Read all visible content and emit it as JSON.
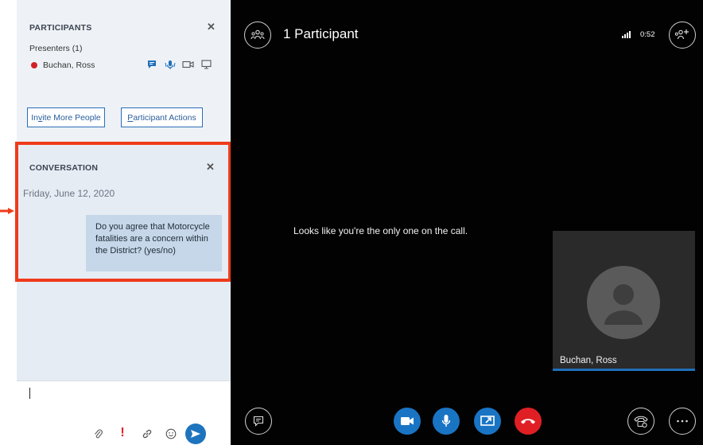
{
  "participants": {
    "title": "PARTICIPANTS",
    "presenters_label": "Presenters (1)",
    "presenter_name": "Buchan, Ross",
    "invite_button": {
      "prefix": "In",
      "underlined": "v",
      "suffix": "ite More People"
    },
    "actions_button": {
      "underlined": "P",
      "suffix": "articipant Actions"
    }
  },
  "conversation": {
    "title": "CONVERSATION",
    "date": "Friday, June 12, 2020",
    "message": "Do you agree that Motorcycle fatalities are a concern within the District? (yes/no)"
  },
  "call": {
    "title": "1 Participant",
    "timer": "0:52",
    "empty_message": "Looks like you're the only one on the call.",
    "self_name": "Buchan, Ross"
  },
  "colors": {
    "highlight": "#ef3b1a",
    "accent_blue": "#1a74c4",
    "hangup_red": "#e01f24",
    "presence_busy": "#d0212a"
  },
  "icons": {
    "participants_panel": "people-icon",
    "add_people": "add-person-icon",
    "signal": "signal-bars-icon",
    "chat": "chat-icon",
    "video": "video-camera-icon",
    "microphone": "microphone-icon",
    "share": "present-screen-icon",
    "hangup": "hang-up-icon",
    "call_controls": "phone-settings-icon",
    "more": "more-options-icon",
    "attach": "paperclip-icon",
    "importance": "exclamation-icon",
    "link": "link-icon",
    "emoji": "smiley-icon",
    "send": "send-icon"
  }
}
